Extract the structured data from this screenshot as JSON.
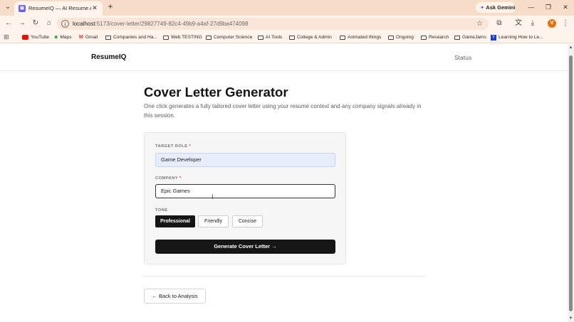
{
  "browser": {
    "tab_title": "ResumeIQ — AI Resume Analy...",
    "tab_close": "✕",
    "new_tab": "+",
    "ask_gemini": "Ask Gemini",
    "url_host": "localhost",
    "url_path": ":5173/cover-letter/29827749-82c4-49b9-a4af-27d9ba474098",
    "profile_initial": "V",
    "bookmarks": [
      {
        "label": "YouTube",
        "icon": "youtube-icon"
      },
      {
        "label": "Maps",
        "icon": "maps-icon"
      },
      {
        "label": "Gmail",
        "icon": "gmail-icon"
      },
      {
        "label": "Companies and Ha...",
        "icon": "folder-icon"
      },
      {
        "label": "Web TESTING",
        "icon": "folder-icon"
      },
      {
        "label": "Computer Science",
        "icon": "folder-icon"
      },
      {
        "label": "AI Tools",
        "icon": "folder-icon"
      },
      {
        "label": "College & Admin",
        "icon": "folder-icon"
      },
      {
        "label": "Animated things",
        "icon": "folder-icon"
      },
      {
        "label": "Ongoing",
        "icon": "folder-icon"
      },
      {
        "label": "Research",
        "icon": "folder-icon"
      },
      {
        "label": "GameJams",
        "icon": "folder-icon"
      },
      {
        "label": "Learning How to Le...",
        "icon": "y-icon"
      }
    ]
  },
  "site": {
    "brand": "ResumeIQ",
    "status_link": "Status"
  },
  "page": {
    "title": "Cover Letter Generator",
    "subtitle": "One click generates a fully tailored cover letter using your resume context and any company signals already in this session."
  },
  "form": {
    "target_role_label": "TARGET ROLE",
    "target_role_value": "Game Developer",
    "company_label": "COMPANY",
    "company_value": "Epic Games",
    "required_mark": "*",
    "tone_label": "TONE",
    "tones": [
      "Professional",
      "Friendly",
      "Concise"
    ],
    "selected_tone": "Professional",
    "generate_label": "Generate Cover Letter →"
  },
  "back_label": "← Back to Analysis",
  "colors": {
    "tab_strip": "#f7ddc9",
    "primary_button": "#161616",
    "role_input_bg": "#e6eefc",
    "required": "#e03131"
  }
}
